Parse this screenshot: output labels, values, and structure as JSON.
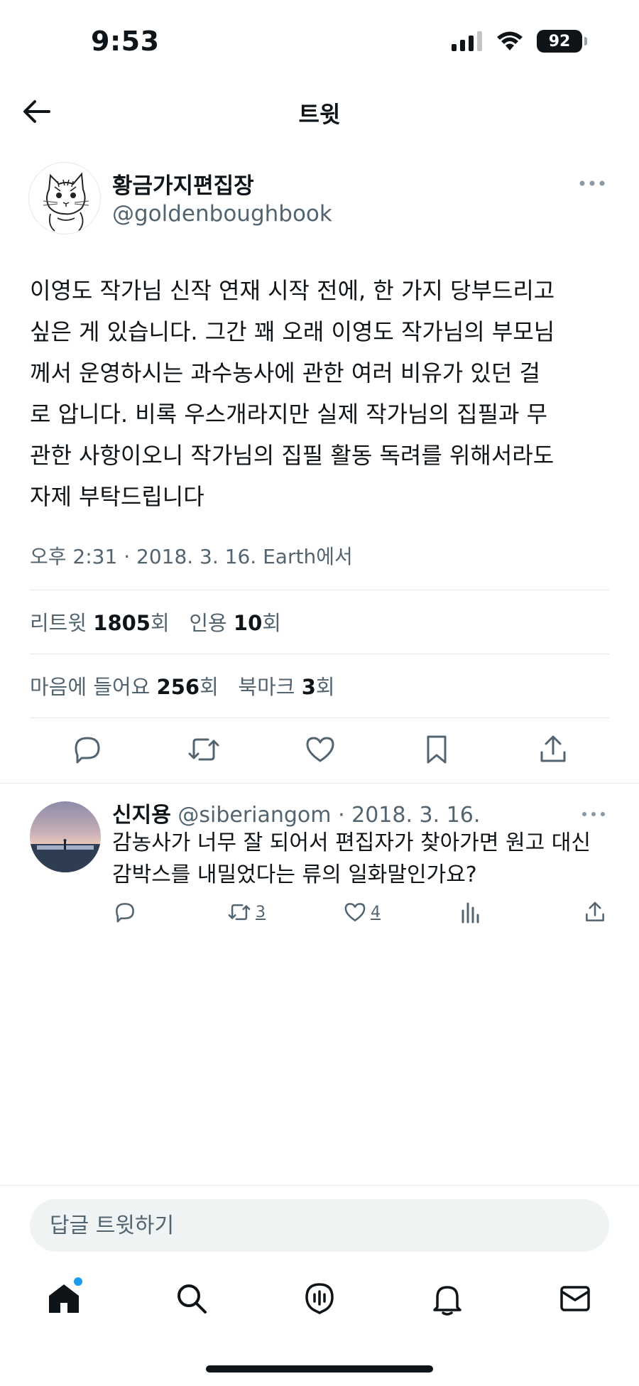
{
  "status_bar": {
    "time": "9:53",
    "battery": "92"
  },
  "header": {
    "title": "트윗"
  },
  "tweet": {
    "author_name": "황금가지편집장",
    "author_handle": "@goldenboughbook",
    "text_lines": [
      "이영도 작가님 신작 연재 시작 전에, 한 가지 당부드리고",
      "싶은 게 있습니다. 그간 꽤 오래 이영도 작가님의 부모님",
      "께서 운영하시는 과수농사에 관한 여러 비유가 있던 걸",
      "로 압니다. 비록 우스개라지만 실제 작가님의 집필과 무",
      "관한 사항이오니 작가님의 집필 활동 독려를 위해서라도",
      "자제 부탁드립니다"
    ],
    "meta": "오후 2:31 · 2018. 3. 16. Earth에서",
    "stats": {
      "retweet_label": "리트윗",
      "retweet_count": "1805",
      "quote_label": "인용",
      "quote_count": "10",
      "times_suffix": "회",
      "like_label": "마음에 들어요",
      "like_count": "256",
      "bookmark_label": "북마크",
      "bookmark_count": "3"
    },
    "action_icons": [
      "reply-icon",
      "retweet-icon",
      "heart-icon",
      "bookmark-icon",
      "share-icon"
    ]
  },
  "reply": {
    "name": "신지용",
    "handle": "@siberiangom",
    "date": "· 2018. 3. 16.",
    "text_lines": [
      "감농사가 너무 잘 되어서 편집자가 찾아가면 원고 대신",
      "감박스를 내밀었다는 류의 일화말인가요?"
    ],
    "retweet_count": "3",
    "like_count": "4"
  },
  "reply_box": {
    "placeholder": "답글 트윗하기"
  },
  "bottom_nav": [
    "home-icon",
    "search-icon",
    "spaces-icon",
    "notifications-icon",
    "messages-icon"
  ],
  "colors": {
    "text": "#0f1419",
    "muted": "#536471",
    "accent": "#1d9bf0",
    "divider": "#e7e7e7"
  }
}
